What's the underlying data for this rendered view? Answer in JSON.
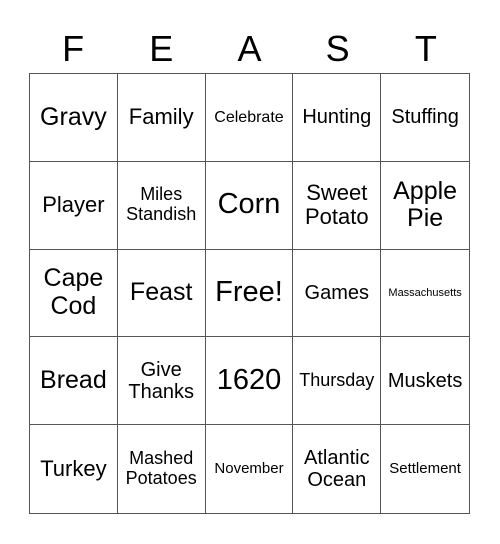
{
  "title_letters": [
    "F",
    "E",
    "A",
    "S",
    "T"
  ],
  "cells": [
    [
      "Gravy",
      "Family",
      "Celebrate",
      "Hunting",
      "Stuffing"
    ],
    [
      "Player",
      "Miles Standish",
      "Corn",
      "Sweet Potato",
      "Apple Pie"
    ],
    [
      "Cape Cod",
      "Feast",
      "Free!",
      "Games",
      "Massachusetts"
    ],
    [
      "Bread",
      "Give Thanks",
      "1620",
      "Thursday",
      "Muskets"
    ],
    [
      "Turkey",
      "Mashed Potatoes",
      "November",
      "Atlantic Ocean",
      "Settlement"
    ]
  ]
}
